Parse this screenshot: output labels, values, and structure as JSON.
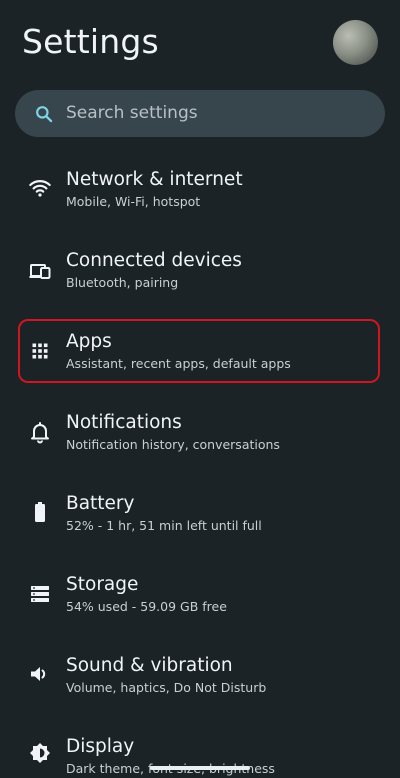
{
  "header": {
    "title": "Settings"
  },
  "search": {
    "placeholder": "Search settings"
  },
  "items": [
    {
      "id": "network",
      "title": "Network & internet",
      "subtitle": "Mobile, Wi-Fi, hotspot",
      "icon": "wifi-icon"
    },
    {
      "id": "connected",
      "title": "Connected devices",
      "subtitle": "Bluetooth, pairing",
      "icon": "devices-icon"
    },
    {
      "id": "apps",
      "title": "Apps",
      "subtitle": "Assistant, recent apps, default apps",
      "icon": "apps-grid-icon"
    },
    {
      "id": "notifications",
      "title": "Notifications",
      "subtitle": "Notification history, conversations",
      "icon": "bell-icon"
    },
    {
      "id": "battery",
      "title": "Battery",
      "subtitle": "52% - 1 hr, 51 min left until full",
      "icon": "battery-icon"
    },
    {
      "id": "storage",
      "title": "Storage",
      "subtitle": "54% used - 59.09 GB free",
      "icon": "storage-icon"
    },
    {
      "id": "sound",
      "title": "Sound & vibration",
      "subtitle": "Volume, haptics, Do Not Disturb",
      "icon": "volume-icon"
    },
    {
      "id": "display",
      "title": "Display",
      "subtitle": "Dark theme, font size, brightness",
      "icon": "display-brightness-icon"
    }
  ],
  "colors": {
    "background": "#1b2327",
    "search_background": "#37464c",
    "accent": "#7fd3e6",
    "highlight": "#d0161e"
  }
}
